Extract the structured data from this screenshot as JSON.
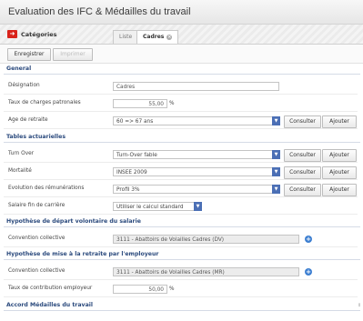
{
  "window": {
    "title": "Evaluation des IFC & Médailles du travail"
  },
  "catbar": {
    "icon": "arrow-right-icon",
    "label": "Catégories",
    "tabs": [
      {
        "label": "Liste"
      },
      {
        "label": "Cadres"
      }
    ]
  },
  "toolbar": {
    "save": "Enregistrer",
    "print": "Imprimer"
  },
  "sections": {
    "general": "General",
    "tables": "Tables actuarielles",
    "depart": "Hypothèse de départ volontaire du salarie",
    "retraite": "Hypothèse de mise à la retraite par l'employeur",
    "medailles": "Accord Médailles du travail"
  },
  "general": {
    "designation": {
      "label": "Désignation",
      "value": "Cadres"
    },
    "taux": {
      "label": "Taux de charges patronales",
      "value": "55,00",
      "unit": "%"
    },
    "age": {
      "label": "Age de retraite",
      "value": "60 => 67 ans"
    }
  },
  "tables": {
    "turnover": {
      "label": "Turn Over",
      "value": "Turn-Over fable"
    },
    "mortalite": {
      "label": "Mortalité",
      "value": "INSEE 2009"
    },
    "evolution": {
      "label": "Evolution des rémunérations",
      "value": "Profil 3%"
    },
    "salaire": {
      "label": "Salaire fin de carrière",
      "value": "Utiliser le calcul standard"
    }
  },
  "depart": {
    "convention": {
      "label": "Convention collective",
      "value": "3111 - Abattoirs de Volailles Cadres (DV)"
    }
  },
  "retraite": {
    "convention": {
      "label": "Convention collective",
      "value": "3111 - Abattoirs de Volailles Cadres (MR)"
    },
    "taux": {
      "label": "Taux de contribution employeur",
      "value": "50,00",
      "unit": "%"
    }
  },
  "actions": {
    "consulter": "Consulter",
    "ajouter": "Ajouter"
  },
  "colors": {
    "accent": "#2b4a7d",
    "brand_red": "#d9231b",
    "select_blue": "#4b6fb5"
  }
}
